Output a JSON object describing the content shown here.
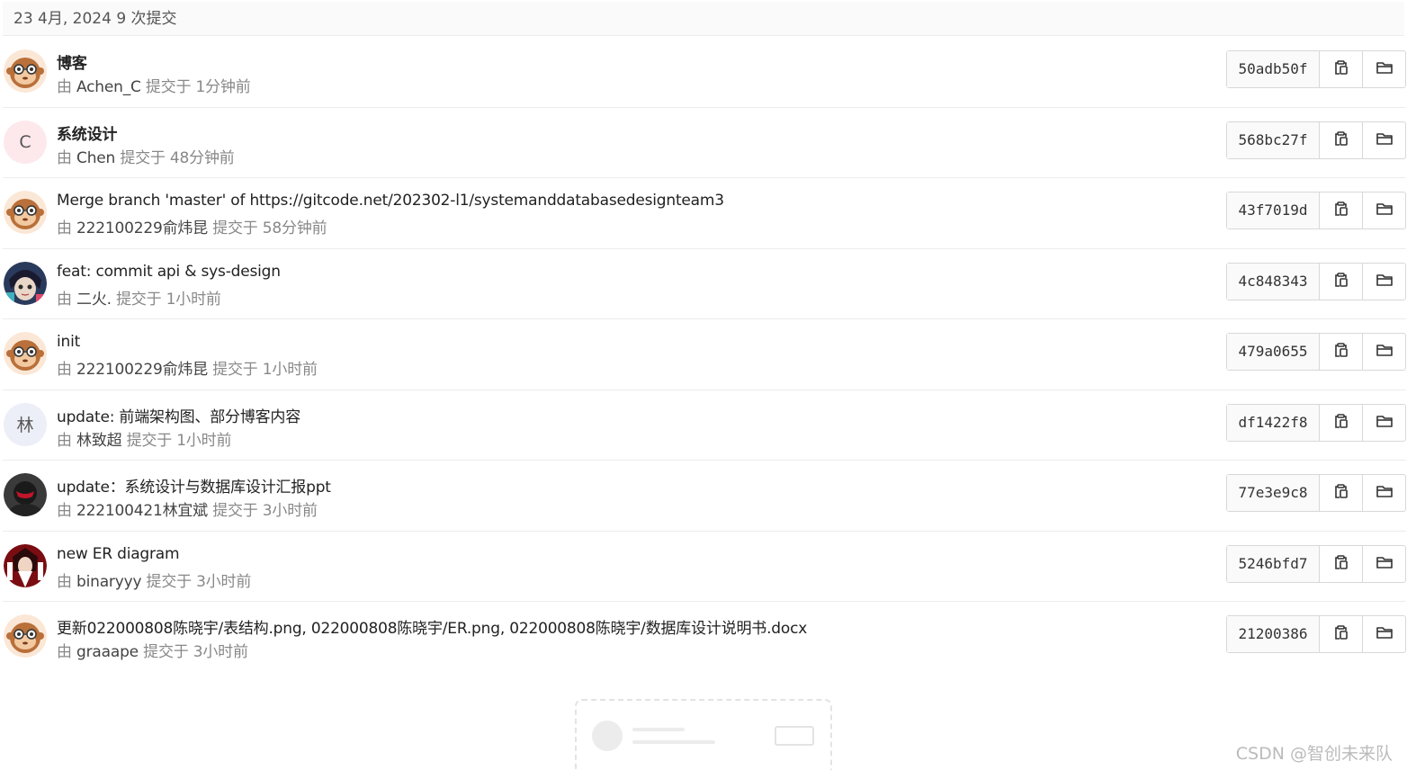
{
  "header": {
    "date_label": "23 4月, 2024 9 次提交"
  },
  "meta_prefix": "由",
  "commits": [
    {
      "title": "博客",
      "title_bold": true,
      "author": "Achen_C",
      "time": "提交于 1分钟前",
      "sha": "50adb50f",
      "avatar": "monkey"
    },
    {
      "title": "系统设计",
      "title_bold": true,
      "author": "Chen",
      "time": "提交于 48分钟前",
      "sha": "568bc27f",
      "avatar": "letter",
      "avatar_letter": "C",
      "avatar_bg": "#fde8ec"
    },
    {
      "title": "Merge branch 'master' of https://gitcode.net/202302-l1/systemanddatabasedesignteam3",
      "title_bold": false,
      "author": "222100229俞炜昆",
      "time": "提交于 58分钟前",
      "sha": "43f7019d",
      "avatar": "monkey"
    },
    {
      "title": "feat: commit api & sys-design",
      "title_bold": false,
      "author": "二火.",
      "time": "提交于 1小时前",
      "sha": "4c848343",
      "avatar": "anime"
    },
    {
      "title": "init",
      "title_bold": false,
      "author": "222100229俞炜昆",
      "time": "提交于 1小时前",
      "sha": "479a0655",
      "avatar": "monkey"
    },
    {
      "title": "update: 前端架构图、部分博客内容",
      "title_bold": false,
      "author": "林致超",
      "time": "提交于 1小时前",
      "sha": "df1422f8",
      "avatar": "letter",
      "avatar_letter": "林",
      "avatar_bg": "#eceef8"
    },
    {
      "title": "update：系统设计与数据库设计汇报ppt",
      "title_bold": false,
      "author": "222100421林宜斌",
      "time": "提交于 3小时前",
      "sha": "77e3e9c8",
      "avatar": "dark"
    },
    {
      "title": "new ER diagram",
      "title_bold": false,
      "author": "binaryyy",
      "time": "提交于 3小时前",
      "sha": "5246bfd7",
      "avatar": "red"
    },
    {
      "title": "更新022000808陈晓宇/表结构.png, 022000808陈晓宇/ER.png, 022000808陈晓宇/数据库设计说明书.docx",
      "title_bold": false,
      "author": "graaape",
      "time": "提交于 3小时前",
      "sha": "21200386",
      "avatar": "monkey"
    }
  ],
  "icons": {
    "copy": "copy-icon",
    "browse": "folder-icon"
  },
  "watermark": "CSDN @智创未来队"
}
